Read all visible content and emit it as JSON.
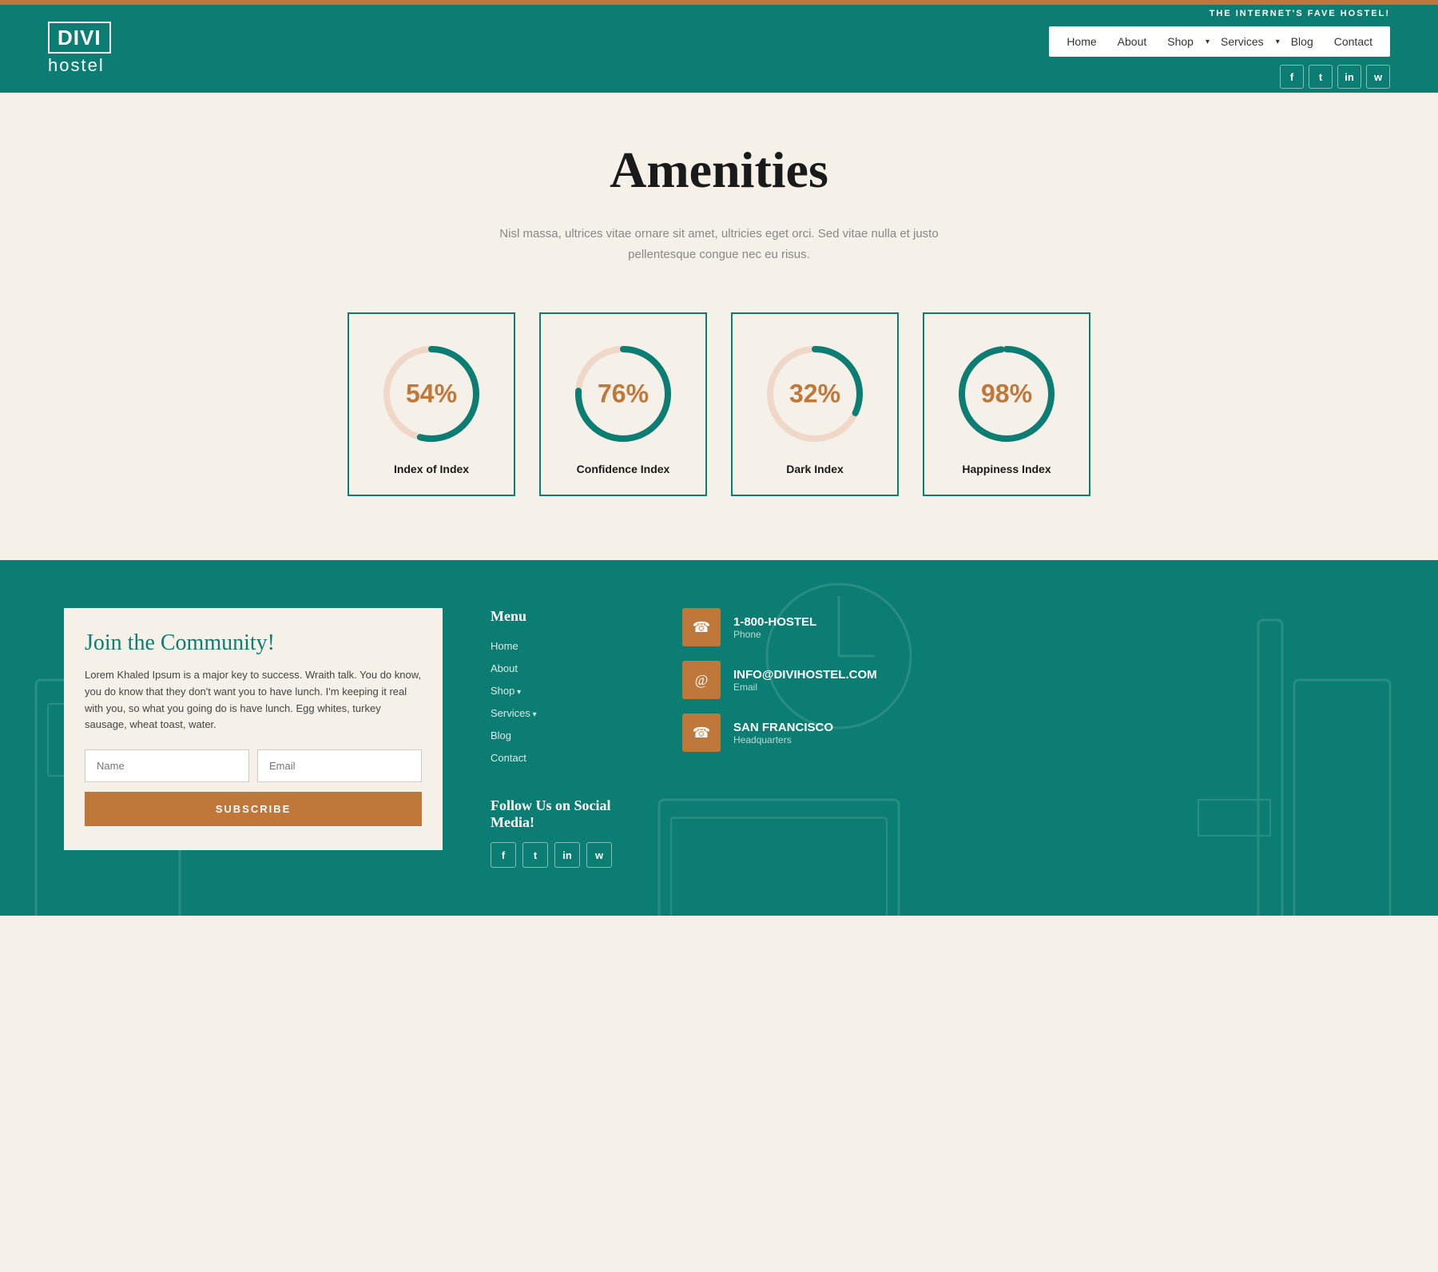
{
  "topbar": {},
  "header": {
    "logo_line1": "DIVI",
    "logo_line2": "hostel",
    "tagline": "THE INTERNET'S FAVE HOSTEL!",
    "nav": {
      "home": "Home",
      "about": "About",
      "shop": "Shop",
      "services": "Services",
      "blog": "Blog",
      "contact": "Contact"
    },
    "social": {
      "facebook": "f",
      "twitter": "t",
      "instagram": "in",
      "whatsapp": "w"
    }
  },
  "main": {
    "title": "Amenities",
    "subtitle": "Nisl massa, ultrices vitae ornare sit amet, ultricies eget orci. Sed vitae nulla et justo pellentesque congue nec eu risus.",
    "metrics": [
      {
        "id": "index",
        "value": "54%",
        "percent": 54,
        "label": "Index of Index"
      },
      {
        "id": "confidence",
        "value": "76%",
        "percent": 76,
        "label": "Confidence Index"
      },
      {
        "id": "dark",
        "value": "32%",
        "percent": 32,
        "label": "Dark Index"
      },
      {
        "id": "happiness",
        "value": "98%",
        "percent": 98,
        "label": "Happiness Index"
      }
    ]
  },
  "footer": {
    "community": {
      "title": "Join the Community!",
      "text": "Lorem Khaled Ipsum is a major key to success. Wraith talk. You do know, you do know that they don't want you to have lunch. I'm keeping it real with you, so what you going do is have lunch. Egg whites, turkey sausage, wheat toast, water.",
      "name_placeholder": "Name",
      "email_placeholder": "Email",
      "subscribe_label": "SUBSCRIBE"
    },
    "menu": {
      "title": "Menu",
      "items": [
        {
          "label": "Home",
          "has_arrow": false
        },
        {
          "label": "About",
          "has_arrow": false
        },
        {
          "label": "Shop",
          "has_arrow": true
        },
        {
          "label": "Services",
          "has_arrow": true
        },
        {
          "label": "Blog",
          "has_arrow": false
        },
        {
          "label": "Contact",
          "has_arrow": false
        }
      ]
    },
    "social": {
      "title": "Follow Us on Social Media!",
      "icons": [
        "f",
        "t",
        "in",
        "w"
      ]
    },
    "contact": {
      "items": [
        {
          "icon": "phone",
          "title": "1-800-HOSTEL",
          "subtitle": "Phone"
        },
        {
          "icon": "email",
          "title": "INFO@DIVIHOSTEL.COM",
          "subtitle": "Email"
        },
        {
          "icon": "location",
          "title": "SAN FRANCISCO",
          "subtitle": "Headquarters"
        }
      ]
    }
  }
}
